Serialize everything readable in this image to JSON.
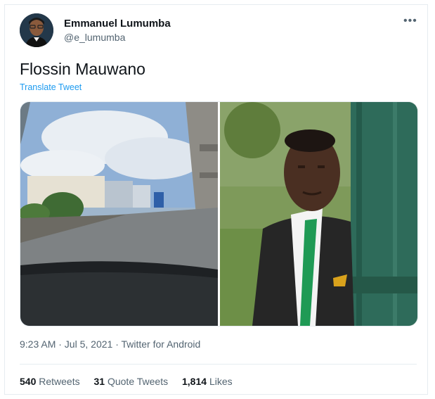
{
  "author": {
    "name": "Emmanuel Lumumba",
    "handle": "@e_lumumba"
  },
  "tweet": {
    "text": "Flossin Mauwano",
    "translate_label": "Translate Tweet",
    "timestamp": "9:23 AM · Jul 5, 2021 · Twitter for Android"
  },
  "stats": {
    "retweets_count": "540",
    "retweets_label": "Retweets",
    "quote_count": "31",
    "quote_label": "Quote Tweets",
    "likes_count": "1,814",
    "likes_label": "Likes"
  },
  "icons": {
    "more": "more-icon"
  },
  "colors": {
    "accent": "#1d9bf0",
    "secondary_text": "#536471",
    "primary_text": "#0f1419"
  }
}
